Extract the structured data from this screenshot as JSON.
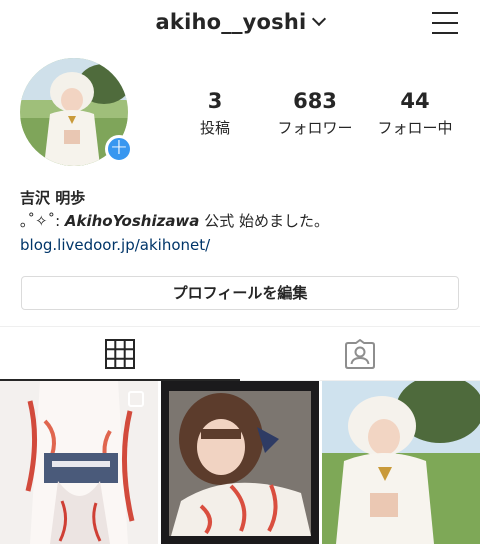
{
  "header": {
    "username": "akiho__yoshi"
  },
  "profile": {
    "stats": [
      {
        "value": "3",
        "label": "投稿"
      },
      {
        "value": "683",
        "label": "フォロワー"
      },
      {
        "value": "44",
        "label": "フォロー中"
      }
    ],
    "name": "吉沢 明歩",
    "bio_prefix": "｡˚✧˚: ",
    "bio_name_bold": "AkihoYoshizawa",
    "bio_suffix": " 公式 始めました。",
    "link": "blog.livedoor.jp/akihonet/"
  },
  "actions": {
    "edit_profile_label": "プロフィールを編集"
  },
  "icons": {
    "menu": "hamburger-menu-icon",
    "dropdown": "chevron-down-icon",
    "add": "plus-icon",
    "grid_tab": "grid-icon",
    "tagged_tab": "tagged-person-icon",
    "multi_post": "multiple-posts-icon"
  },
  "colors": {
    "accent_blue": "#3897f0",
    "link": "#003569",
    "border": "#dbdbdb"
  }
}
